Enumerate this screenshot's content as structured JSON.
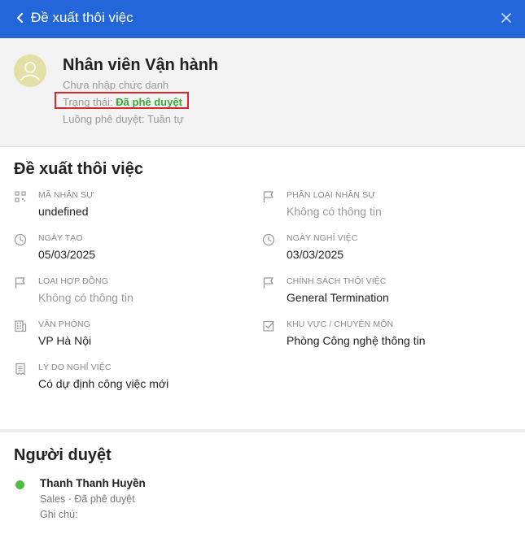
{
  "header": {
    "title": "Đề xuất thôi việc",
    "back_icon": "chevron-left-icon",
    "close_icon": "close-icon",
    "color": "#2266d9"
  },
  "profile": {
    "name": "Nhân viên Vận hành",
    "subtitle": "Chưa nhập chức danh",
    "status_label": "Trạng thái: ",
    "status_value": "Đã phê duyệt",
    "status_color": "#3aa63a",
    "flow": "Luồng phê duyệt: Tuần tự",
    "avatar_icon": "user-avatar-icon"
  },
  "details": {
    "title": "Đề xuất thôi việc",
    "fields": [
      {
        "label": "Mã nhân sự",
        "value": "undefined",
        "icon": "qr-code-icon",
        "muted": false
      },
      {
        "label": "Phân loại nhân sự",
        "value": "Không có thông tin",
        "icon": "flag-icon",
        "muted": true
      },
      {
        "label": "Ngày tạo",
        "value": "05/03/2025",
        "icon": "clock-icon",
        "muted": false
      },
      {
        "label": "Ngày nghỉ việc",
        "value": "03/03/2025",
        "icon": "clock-icon",
        "muted": false
      },
      {
        "label": "Loại hợp đồng",
        "value": "Không có thông tin",
        "icon": "flag-icon",
        "muted": true
      },
      {
        "label": "Chính sách thôi việc",
        "value": "General Termination",
        "icon": "flag-icon",
        "muted": false
      },
      {
        "label": "Văn phòng",
        "value": "VP Hà Nội",
        "icon": "building-icon",
        "muted": false
      },
      {
        "label": "Khu vực / Chuyên môn",
        "value": "Phòng Công nghệ thông tin",
        "icon": "checkbox-icon",
        "muted": false
      },
      {
        "label": "Lý do nghỉ việc",
        "value": "Có dự định công việc mới",
        "icon": "receipt-icon",
        "muted": false
      }
    ]
  },
  "approvers": {
    "title": "Người duyệt",
    "items": [
      {
        "name": "Thanh Thanh Huyền",
        "meta": "Sales · Đã phê duyệt",
        "note": "Ghi chú:",
        "status_color": "#4cbf3c"
      }
    ]
  }
}
